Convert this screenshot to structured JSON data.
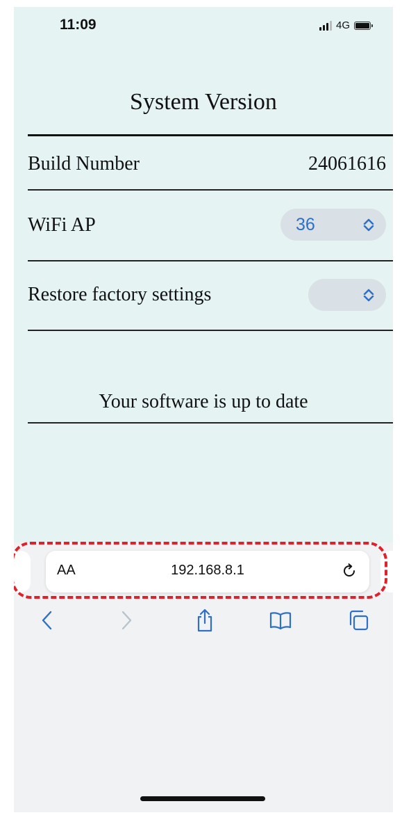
{
  "status_bar": {
    "time": "11:09",
    "network": "4G"
  },
  "page": {
    "title": "System Version",
    "rows": {
      "build": {
        "label": "Build Number",
        "value": "24061616"
      },
      "wifi": {
        "label": "WiFi AP",
        "selected": "36"
      },
      "restore": {
        "label": "Restore factory settings",
        "selected": ""
      }
    },
    "update_message": "Your software is up to date"
  },
  "browser": {
    "text_size_label": "AA",
    "url": "192.168.8.1",
    "icons": [
      "reload-icon",
      "back-icon",
      "forward-icon",
      "share-icon",
      "bookmarks-icon",
      "tabs-icon"
    ]
  },
  "colors": {
    "page_bg": "#e5f3f3",
    "select_text": "#2f6fc4",
    "highlight_dash": "#e0202a"
  }
}
